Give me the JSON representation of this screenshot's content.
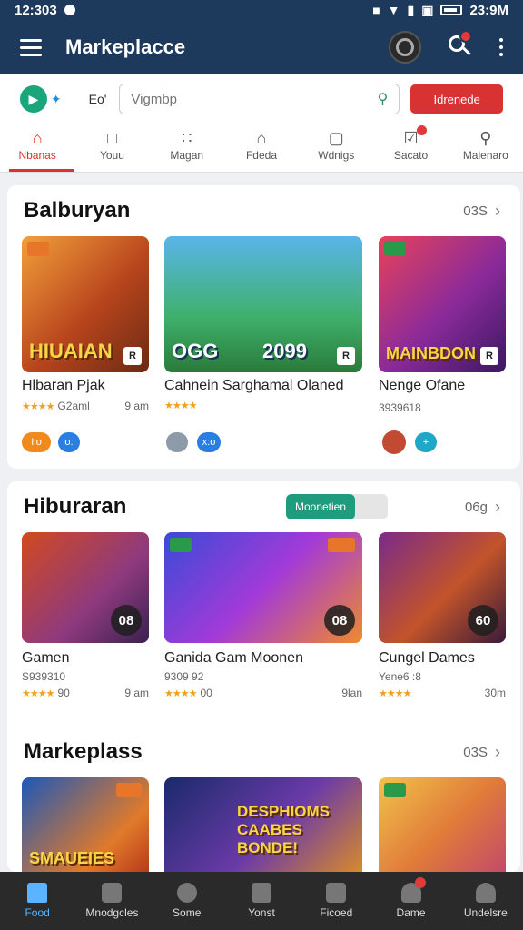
{
  "status_bar": {
    "time": "12:303",
    "right_time": "23:9M"
  },
  "app_bar": {
    "title": "Markeplacce"
  },
  "search_row": {
    "label": "Eo'",
    "placeholder": "Vigmbp",
    "button": "Idrenede"
  },
  "tabs": [
    {
      "label": "Nbanas",
      "icon": "home-icon",
      "active": true
    },
    {
      "label": "Youu",
      "icon": "square-icon"
    },
    {
      "label": "Magan",
      "icon": "grid-dots-icon"
    },
    {
      "label": "Fdeda",
      "icon": "house-outline-icon"
    },
    {
      "label": "Wdnigs",
      "icon": "window-icon"
    },
    {
      "label": "Sacato",
      "icon": "check-box-icon"
    },
    {
      "label": "Malenaro",
      "icon": "search-icon"
    }
  ],
  "section1": {
    "title": "Balburyan",
    "more": "03S",
    "cards": [
      {
        "thumb_text": "HIUAIAN",
        "name": "Hlbaran Pjak",
        "rating_text": "G2aml",
        "time": "9 am",
        "tags": [
          "Ilo",
          "o:"
        ]
      },
      {
        "thumb_text": "2099",
        "thumb_text2": "OGG",
        "name": "Cahnein Sarghamal Olaned",
        "tags": [
          "",
          "x:o"
        ]
      },
      {
        "thumb_text": "MAINBDON",
        "name": "Nenge Ofane",
        "meta": "3939618",
        "tags": [
          "",
          "+"
        ]
      }
    ]
  },
  "section2": {
    "title": "Hiburaran",
    "pill": "Moonetien",
    "more": "06g",
    "cards": [
      {
        "badge": "08",
        "name": "Gamen",
        "meta": "S939310",
        "rating_text": "90",
        "time": "9 am"
      },
      {
        "badge": "08",
        "name": "Ganida Gam Moonen",
        "meta": "9309 92",
        "rating_text": "00",
        "time": "9lan"
      },
      {
        "badge": "60",
        "name": "Cungel Dames",
        "meta": "Yene6 :8",
        "time": "30m"
      }
    ]
  },
  "section3": {
    "title": "Markeplass",
    "more": "03S",
    "cards": [
      {
        "thumb_text": "SMAUEIES"
      },
      {
        "thumb_text": "DESPHIOMS CAABES BONDE!"
      },
      {
        "thumb_text": ""
      }
    ]
  },
  "bottom_nav": [
    {
      "label": "Food",
      "icon": "home-icon",
      "active": true
    },
    {
      "label": "Mnodgcles",
      "icon": "grid-icon"
    },
    {
      "label": "Some",
      "icon": "search-icon"
    },
    {
      "label": "Yonst",
      "icon": "check-icon"
    },
    {
      "label": "Ficoed",
      "icon": "document-icon"
    },
    {
      "label": "Dame",
      "icon": "person-icon"
    },
    {
      "label": "Undelsre",
      "icon": "profile-icon"
    }
  ]
}
